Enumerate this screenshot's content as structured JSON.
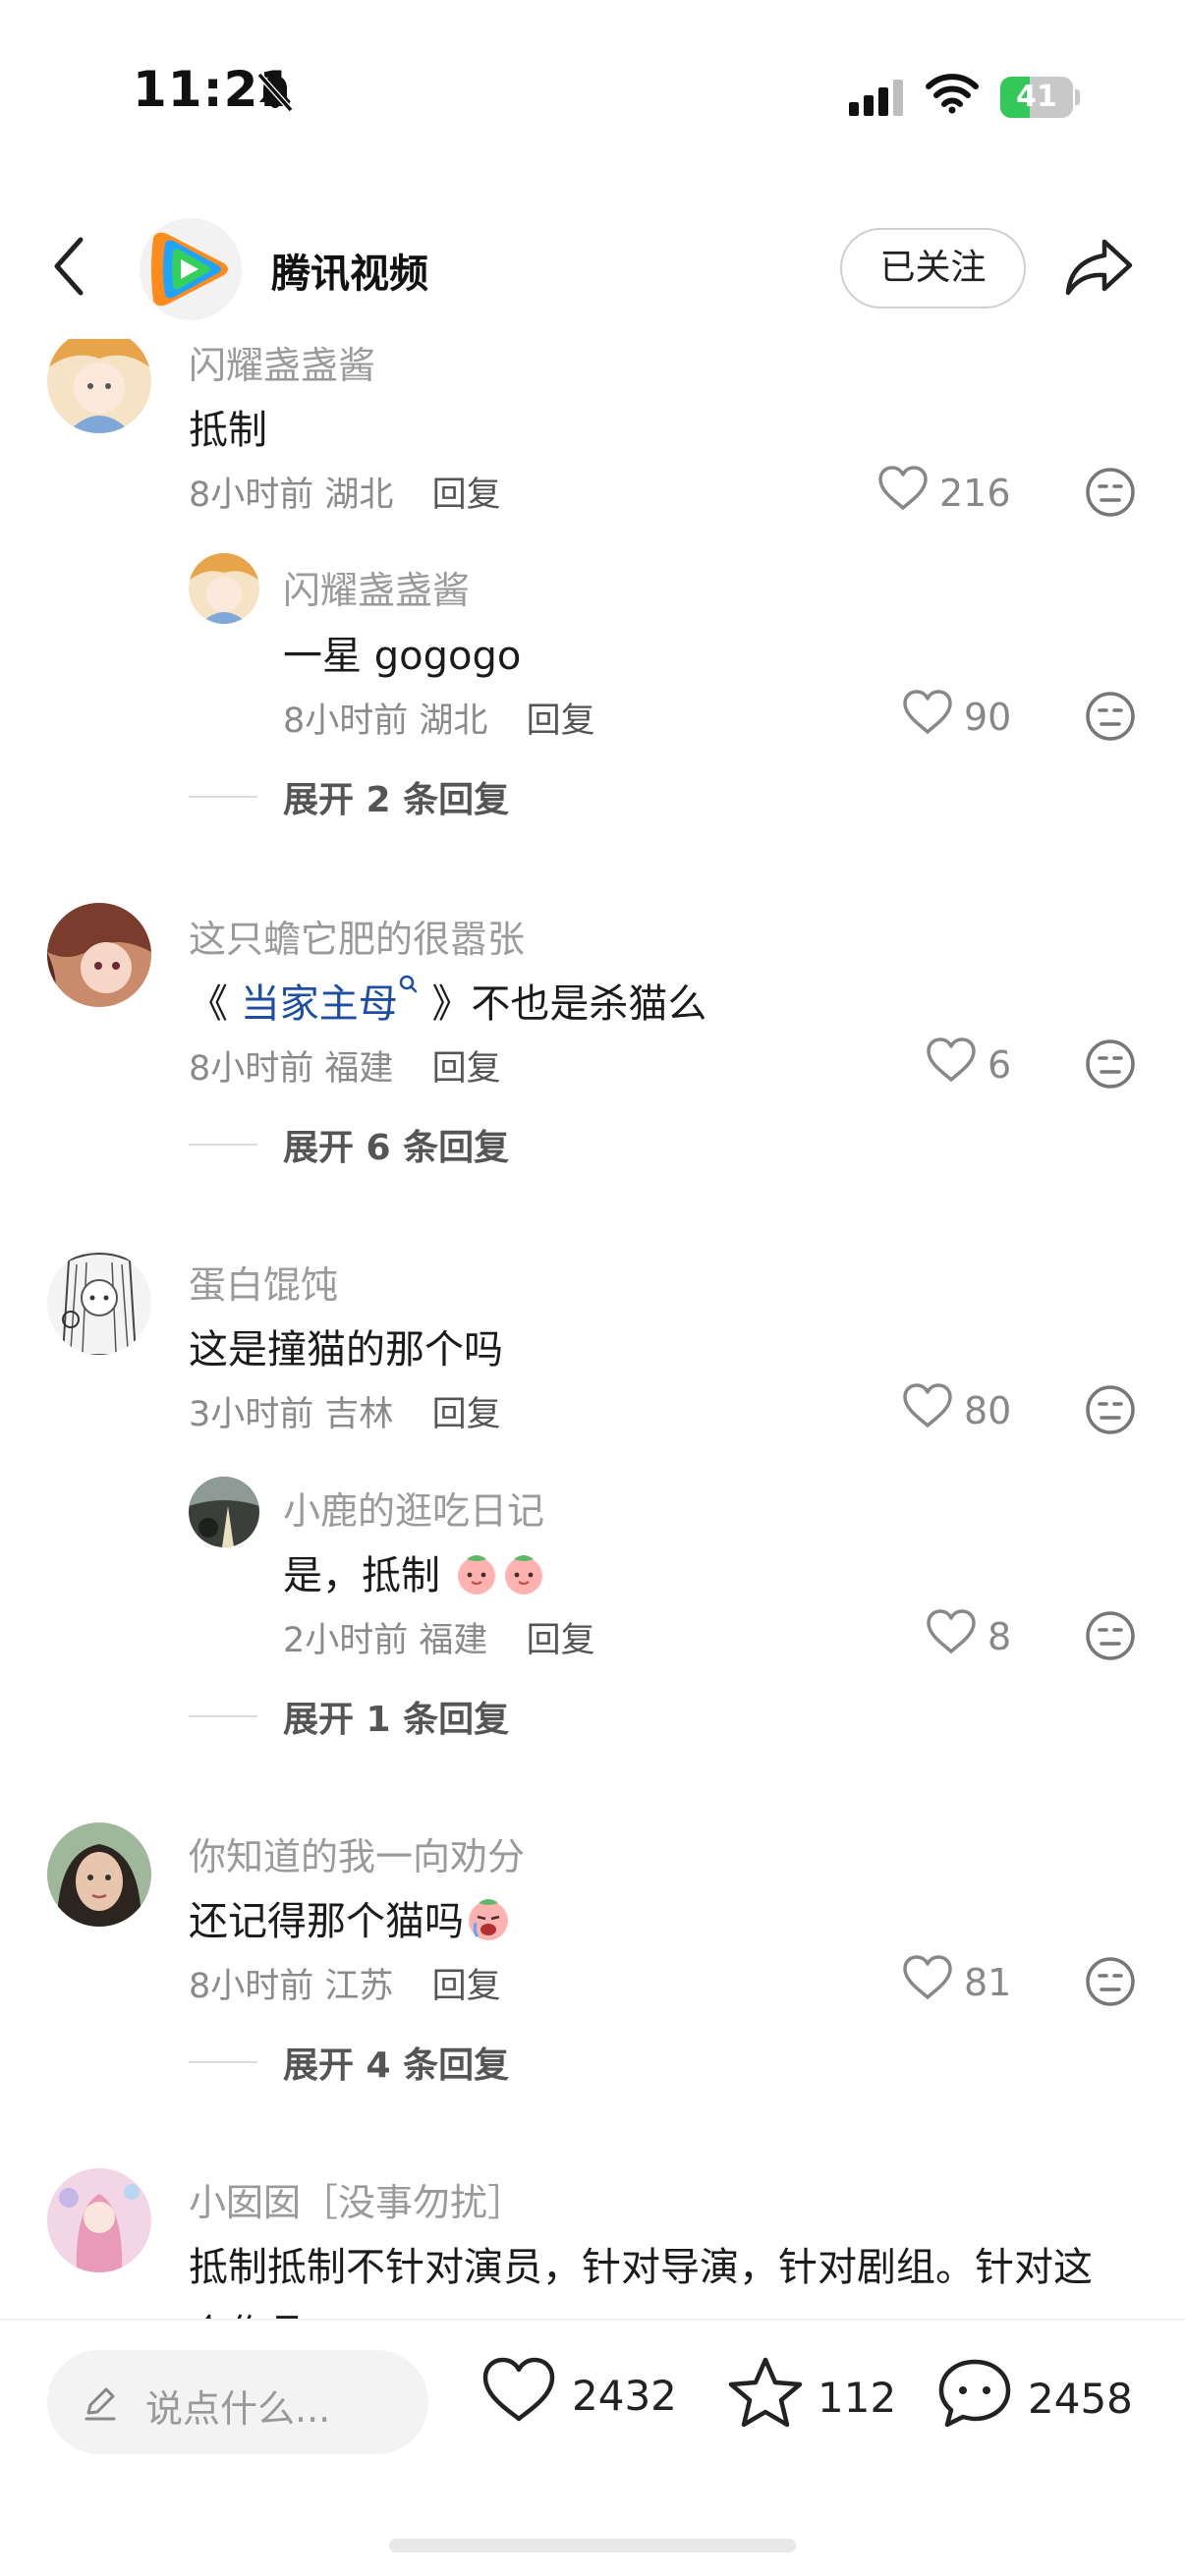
{
  "status_bar": {
    "time": "11:21",
    "battery": "41",
    "battery_level": 0.41,
    "icons": [
      "bell-slash-icon",
      "cellular-signal-icon",
      "wifi-icon",
      "battery-charging-icon"
    ]
  },
  "header": {
    "channel_name": "腾讯视频",
    "follow_label": "已关注",
    "icons": [
      "back-chevron-icon",
      "tencent-video-logo",
      "share-arrow-icon"
    ]
  },
  "comments": [
    {
      "username": "闪耀盏盏酱",
      "text": "抵制",
      "time": "8小时前",
      "location": "湖北",
      "reply_label": "回复",
      "likes": "216",
      "replies": [
        {
          "username": "闪耀盏盏酱",
          "text": "一星 gogogo",
          "time": "8小时前",
          "location": "湖北",
          "reply_label": "回复",
          "likes": "90"
        }
      ],
      "expand_label": "展开 2 条回复"
    },
    {
      "username": "这只蟾它肥的很嚣张",
      "text_prefix": "《",
      "hashtag": "当家主母",
      "text_suffix": "》不也是杀猫么",
      "time": "8小时前",
      "location": "福建",
      "reply_label": "回复",
      "likes": "6",
      "expand_label": "展开 6 条回复"
    },
    {
      "username": "蛋白馄饨",
      "text": "这是撞猫的那个吗",
      "time": "3小时前",
      "location": "吉林",
      "reply_label": "回复",
      "likes": "80",
      "replies": [
        {
          "username": "小鹿的逛吃日记",
          "text": "是，抵制",
          "emoji": [
            "peach-emoji",
            "peach-emoji"
          ],
          "time": "2小时前",
          "location": "福建",
          "reply_label": "回复",
          "likes": "8"
        }
      ],
      "expand_label": "展开 1 条回复"
    },
    {
      "username": "你知道的我一向劝分",
      "text": "还记得那个猫吗",
      "emoji": [
        "crying-peach-emoji"
      ],
      "time": "8小时前",
      "location": "江苏",
      "reply_label": "回复",
      "likes": "81",
      "expand_label": "展开 4 条回复"
    },
    {
      "username": "小囡囡［没事勿扰］",
      "text": "抵制抵制不针对演员，针对导演，针对剧组。针对这",
      "text_cut": "个作品"
    }
  ],
  "bottom_bar": {
    "input_placeholder": "说点什么...",
    "likes": "2432",
    "favorites": "112",
    "comments": "2458",
    "icons": [
      "pen-icon",
      "heart-icon",
      "star-icon",
      "comment-bubble-icon"
    ]
  }
}
